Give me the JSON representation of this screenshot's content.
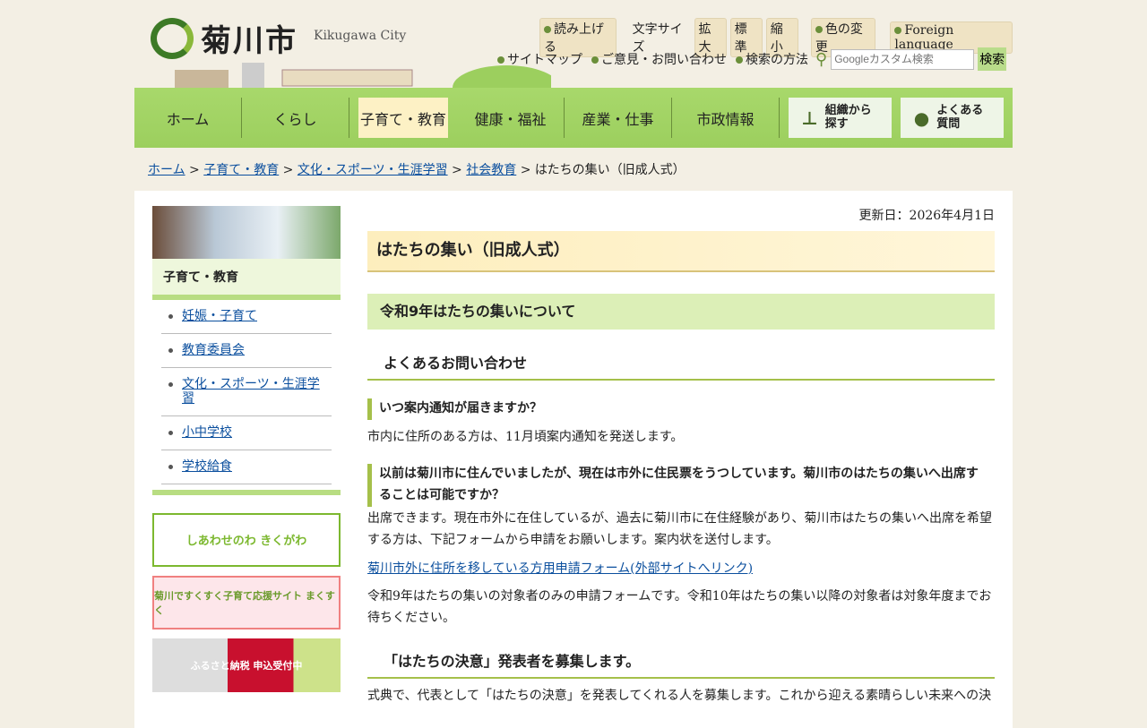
{
  "header": {
    "logo": "菊川市",
    "logo_en": "Kikugawa City",
    "read_aloud": "読み上げる",
    "font_size_label": "文字サイズ",
    "font_large": "拡大",
    "font_normal": "標準",
    "font_small": "縮小",
    "color_change": "色の変更",
    "foreign": "Foreign language",
    "sitemap": "サイトマップ",
    "contact": "ご意見・お問い合わせ",
    "search_help": "検索の方法",
    "search_placeholder": "Googleカスタム検索",
    "search_button": "検索"
  },
  "nav": {
    "items": [
      "ホーム",
      "くらし",
      "子育て・教育",
      "健康・福祉",
      "産業・仕事",
      "市政情報"
    ],
    "org": "組織から探す",
    "faq": "よくある質問"
  },
  "breadcrumb": [
    "ホーム",
    "子育て・教育",
    "文化・スポーツ・生涯学習",
    "社会教育",
    "はたちの集い（旧成人式）"
  ],
  "sidebar": {
    "title": "子育て・教育",
    "items": [
      "妊娠・子育て",
      "教育委員会",
      "文化・スポーツ・生涯学習",
      "小中学校",
      "学校給食"
    ],
    "banners": [
      "しあわせのわ きくがわ",
      "菊川ですくすく子育て応援サイト まくすく",
      "ふるさと納税 申込受付中"
    ]
  },
  "content": {
    "updated": "更新日：2026年4月1日",
    "title": "はたちの集い（旧成人式）",
    "h2": "令和9年はたちの集いについて",
    "h3_faq": "よくあるお問い合わせ",
    "q1": "いつ案内通知が届きますか？",
    "a1": "市内に住所のある方は、11月頃案内通知を発送します。",
    "q2": "以前は菊川市に住んでいましたが、現在は市外に住民票をうつしています。菊川市のはたちの集いへ出席することは可能ですか？",
    "a2": "出席できます。現在市外に在住しているが、過去に菊川市に在住経験があり、菊川市はたちの集いへ出席を希望する方は、下記フォームから申請をお願いします。案内状を送付します。",
    "link": "菊川市外に住所を移している方用申請フォーム(外部サイトへリンク)",
    "note": "令和9年はたちの集いの対象者のみの申請フォームです。令和10年はたちの集い以降の対象者は対象年度までお待ちください。",
    "h3_2": "「はたちの決意」発表者を募集します。",
    "p3": "式典で、代表として「はたちの決意」を発表してくれる人を募集します。これから迎える素晴らしい未来への決"
  }
}
